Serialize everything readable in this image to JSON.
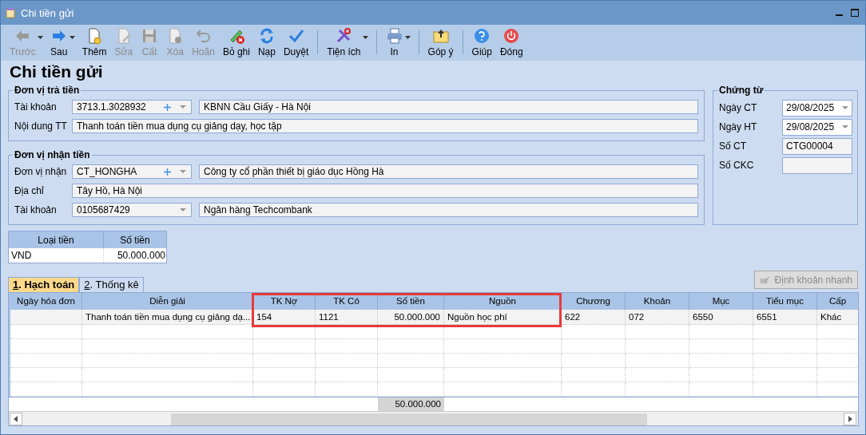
{
  "window": {
    "title": "Chi tiền gửi"
  },
  "toolbar": [
    {
      "kind": "back",
      "label": "Trước",
      "disabled": true,
      "dropdown": true
    },
    {
      "kind": "forward",
      "label": "Sau",
      "disabled": false,
      "dropdown": true
    },
    {
      "kind": "new",
      "label": "Thêm",
      "disabled": false,
      "dropdown": false
    },
    {
      "kind": "edit",
      "label": "Sửa",
      "disabled": true,
      "dropdown": false
    },
    {
      "kind": "save",
      "label": "Cất",
      "disabled": true,
      "dropdown": false
    },
    {
      "kind": "delete",
      "label": "Xóa",
      "disabled": true,
      "dropdown": false
    },
    {
      "kind": "undo",
      "label": "Hoãn",
      "disabled": true,
      "dropdown": false
    },
    {
      "kind": "unpost",
      "label": "Bỏ ghi",
      "disabled": false,
      "dropdown": false
    },
    {
      "kind": "reload",
      "label": "Nạp",
      "disabled": false,
      "dropdown": false
    },
    {
      "kind": "approve",
      "label": "Duyệt",
      "disabled": false,
      "dropdown": false
    },
    {
      "kind": "separator"
    },
    {
      "kind": "tools",
      "label": "Tiện ích",
      "disabled": false,
      "dropdown": true
    },
    {
      "kind": "separator"
    },
    {
      "kind": "print",
      "label": "In",
      "disabled": false,
      "dropdown": true
    },
    {
      "kind": "separator"
    },
    {
      "kind": "feedback",
      "label": "Góp ý",
      "disabled": false,
      "dropdown": false
    },
    {
      "kind": "separator"
    },
    {
      "kind": "help",
      "label": "Giúp",
      "disabled": false,
      "dropdown": false
    },
    {
      "kind": "close",
      "label": "Đóng",
      "disabled": false,
      "dropdown": false
    }
  ],
  "form_title": "Chi tiền gửi",
  "payer": {
    "legend": "Đơn vị trả tiền",
    "rows": [
      {
        "kind": "combo",
        "label": "Tài khoản",
        "code": "3713.1.3028932",
        "add": true,
        "name": "KBNN Cầu Giấy - Hà Nội"
      },
      {
        "kind": "text",
        "label": "Nội dung TT",
        "value": "Thanh toán tiền mua dụng cụ giảng dạy, học tập"
      }
    ]
  },
  "payee": {
    "legend": "Đơn vị nhận tiền",
    "rows": [
      {
        "kind": "combo",
        "label": "Đơn vị nhận",
        "code": "CT_HONGHA",
        "add": true,
        "name": "Công ty cổ phần thiết bị giáo dục Hồng Hà"
      },
      {
        "kind": "text",
        "label": "Địa chỉ",
        "value": "Tây Hồ, Hà Nội"
      },
      {
        "kind": "combo",
        "label": "Tài khoản",
        "code": "0105687429",
        "add": false,
        "name": "Ngân hàng Techcombank"
      }
    ]
  },
  "voucher": {
    "legend": "Chứng từ",
    "fields": [
      {
        "kind": "date",
        "label": "Ngày CT",
        "value": "29/08/2025"
      },
      {
        "kind": "date",
        "label": "Ngày HT",
        "value": "29/08/2025"
      },
      {
        "kind": "text",
        "label": "Số CT",
        "value": "CTG00004"
      },
      {
        "kind": "text",
        "label": "Số CKC"
      }
    ]
  },
  "currency_table": {
    "columns": [
      "Loại tiền",
      "Số tiền"
    ],
    "rows": [
      [
        "VND",
        "50.000.000"
      ]
    ]
  },
  "tabs": [
    {
      "hotkey": "1",
      "label": ". Hạch toán",
      "selected": true
    },
    {
      "hotkey": "2",
      "label": ". Thống kê",
      "selected": false
    }
  ],
  "quick_button": {
    "label": "Định khoản nhanh",
    "disabled": true
  },
  "grid": {
    "columns": [
      {
        "label": "Ngày hóa đơn",
        "highlighted": false
      },
      {
        "label": "Diễn giải",
        "highlighted": false
      },
      {
        "label": "TK Nợ",
        "highlighted": true
      },
      {
        "label": "TK Có",
        "highlighted": true
      },
      {
        "label": "Số tiền",
        "highlighted": true,
        "total": "50.000.000"
      },
      {
        "label": "Nguồn",
        "highlighted": true
      },
      {
        "label": "Chương",
        "highlighted": false
      },
      {
        "label": "Khoản",
        "highlighted": false
      },
      {
        "label": "Mục",
        "highlighted": false
      },
      {
        "label": "Tiểu mục",
        "highlighted": false
      },
      {
        "label": "Cấp",
        "highlighted": false
      }
    ],
    "rows": [
      [
        null,
        "Thanh toán tiền mua dụng cụ giảng dạ...",
        "154",
        "1121",
        "50.000.000",
        "Nguồn học phí",
        "622",
        "072",
        "6550",
        "6551",
        "Khác"
      ]
    ]
  }
}
